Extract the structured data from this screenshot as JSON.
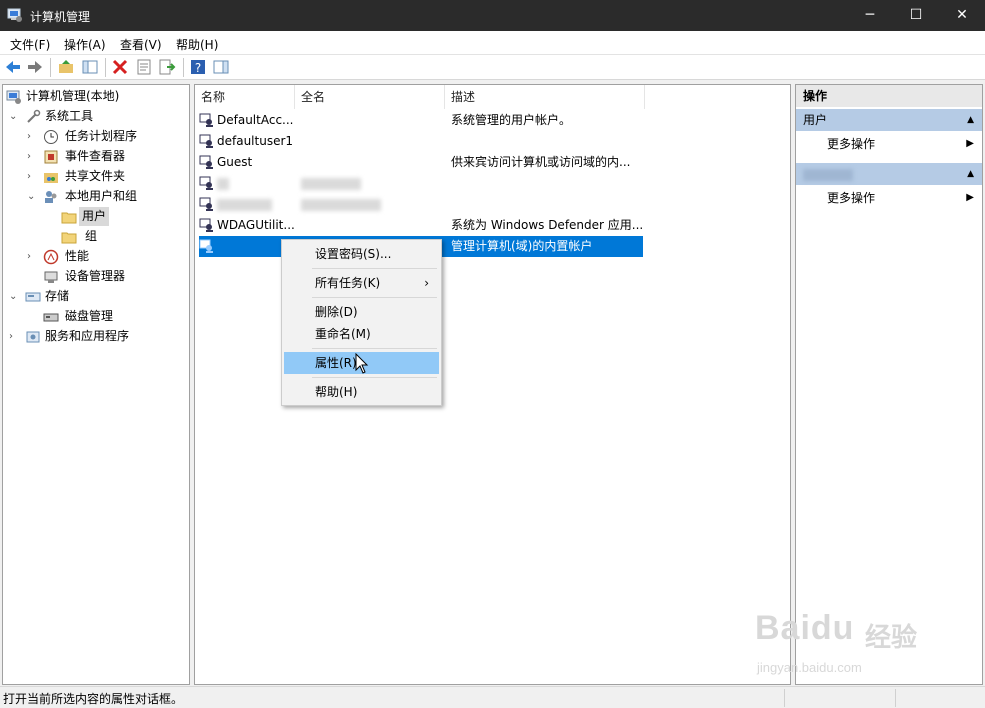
{
  "window": {
    "title": "计算机管理",
    "minimize": "─",
    "maximize": "☐",
    "close": "✕"
  },
  "menu": [
    "文件(F)",
    "操作(A)",
    "查看(V)",
    "帮助(H)"
  ],
  "tree": {
    "root": "计算机管理(本地)",
    "system_tools": "系统工具",
    "task_scheduler": "任务计划程序",
    "event_viewer": "事件查看器",
    "shared_folders": "共享文件夹",
    "local_users": "本地用户和组",
    "users": "用户",
    "groups": "组",
    "performance": "性能",
    "device_manager": "设备管理器",
    "storage": "存储",
    "disk_management": "磁盘管理",
    "services": "服务和应用程序"
  },
  "list": {
    "columns": {
      "name": "名称",
      "fullname": "全名",
      "description": "描述"
    },
    "rows": [
      {
        "name": "DefaultAcc...",
        "fullname": "",
        "description": "系统管理的用户帐户。"
      },
      {
        "name": "defaultuser1",
        "fullname": "",
        "description": ""
      },
      {
        "name": "Guest",
        "fullname": "",
        "description": "供来宾访问计算机或访问域的内..."
      },
      {
        "name": "",
        "fullname": "",
        "description": ""
      },
      {
        "name": "",
        "fullname": "",
        "description": ""
      },
      {
        "name": "WDAGUtilit...",
        "fullname": "",
        "description": "系统为 Windows Defender 应用..."
      },
      {
        "name": "",
        "fullname": "",
        "description": "管理计算机(域)的内置帐户"
      }
    ]
  },
  "context_menu": {
    "set_password": "设置密码(S)...",
    "all_tasks": "所有任务(K)",
    "submenu_arrow": "›",
    "delete": "删除(D)",
    "rename": "重命名(M)",
    "properties": "属性(R)",
    "help": "帮助(H)"
  },
  "actions": {
    "title": "操作",
    "group1": "用户",
    "more1": "更多操作",
    "group2": "",
    "more2": "更多操作",
    "caret": "▲",
    "more_arrow": "▶"
  },
  "status": {
    "text": "打开当前所选内容的属性对话框。"
  },
  "watermark": {
    "logo": "Baidu",
    "brand": "经验",
    "url": "jingyan.baidu.com"
  },
  "colors": {
    "accent": "#0078d7",
    "highlight": "#91c9f7",
    "group": "#b5cbe5"
  }
}
